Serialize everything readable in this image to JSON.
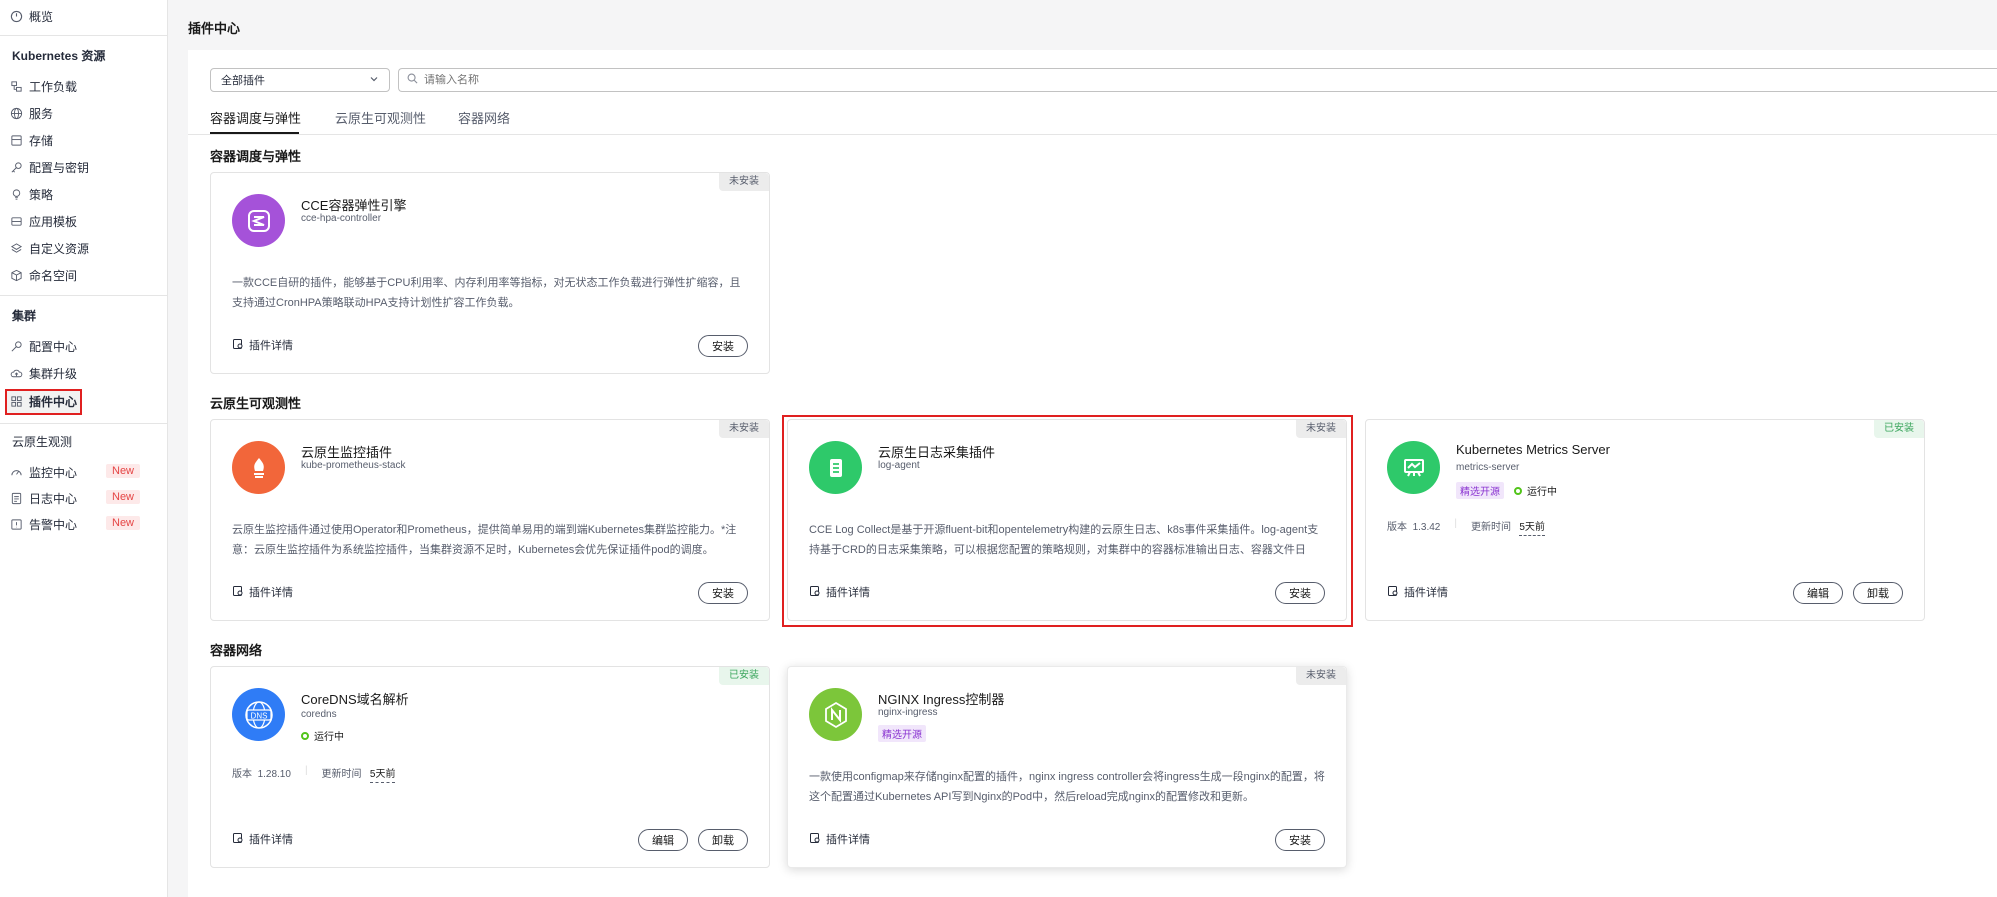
{
  "sidebar": {
    "top_item": "概览",
    "groups": [
      {
        "title": "Kubernetes 资源",
        "items": [
          "工作负载",
          "服务",
          "存储",
          "配置与密钥",
          "策略",
          "应用模板",
          "自定义资源",
          "命名空间"
        ]
      },
      {
        "title": "集群",
        "items": [
          "配置中心",
          "集群升级",
          "插件中心"
        ]
      },
      {
        "title": "云原生观测",
        "items": [
          "监控中心",
          "日志中心",
          "告警中心"
        ]
      }
    ],
    "new_badge": "New"
  },
  "page_title": "插件中心",
  "filter": {
    "selected": "全部插件",
    "search_placeholder": "请输入名称"
  },
  "tabs": [
    "容器调度与弹性",
    "云原生可观测性",
    "容器网络"
  ],
  "sections": [
    {
      "title": "容器调度与弹性",
      "cards": [
        {
          "name": "CCE容器弹性引擎",
          "id": "cce-hpa-controller",
          "status": "未安装",
          "desc": "一款CCE自研的插件，能够基于CPU利用率、内存利用率等指标，对无状态工作负载进行弹性扩缩容，且支持通过CronHPA策略联动HPA支持计划性扩容工作负载。",
          "detail": "插件详情",
          "buttons": [
            "安装"
          ]
        }
      ]
    },
    {
      "title": "云原生可观测性",
      "cards": [
        {
          "name": "云原生监控插件",
          "id": "kube-prometheus-stack",
          "status": "未安装",
          "desc": "云原生监控插件通过使用Operator和Prometheus，提供简单易用的端到端Kubernetes集群监控能力。*注意：云原生监控插件为系统监控插件，当集群资源不足时，Kubernetes会优先保证插件pod的调度。",
          "detail": "插件详情",
          "buttons": [
            "安装"
          ]
        },
        {
          "name": "云原生日志采集插件",
          "id": "log-agent",
          "status": "未安装",
          "desc": "CCE Log Collect是基于开源fluent-bit和opentelemetry构建的云原生日志、k8s事件采集插件。log-agent支持基于CRD的日志采集策略，可以根据您配置的策略规则，对集群中的容器标准输出日志、容器文件日志、…",
          "detail": "插件详情",
          "buttons": [
            "安装"
          ]
        },
        {
          "name": "Kubernetes Metrics Server",
          "id": "metrics-server",
          "status": "已安装",
          "tag": "精选开源",
          "running": "运行中",
          "version_label": "版本",
          "version": "1.3.42",
          "update_label": "更新时间",
          "update": "5天前",
          "detail": "插件详情",
          "buttons": [
            "编辑",
            "卸载"
          ]
        }
      ]
    },
    {
      "title": "容器网络",
      "cards": [
        {
          "name": "CoreDNS域名解析",
          "id": "coredns",
          "status": "已安装",
          "running": "运行中",
          "version_label": "版本",
          "version": "1.28.10",
          "update_label": "更新时间",
          "update": "5天前",
          "detail": "插件详情",
          "buttons": [
            "编辑",
            "卸载"
          ]
        },
        {
          "name": "NGINX Ingress控制器",
          "id": "nginx-ingress",
          "status": "未安装",
          "tag": "精选开源",
          "desc": "一款使用configmap来存储nginx配置的插件，nginx ingress controller会将ingress生成一段nginx的配置，将这个配置通过Kubernetes API写到Nginx的Pod中，然后reload完成nginx的配置修改和更新。",
          "detail": "插件详情",
          "buttons": [
            "安装"
          ]
        }
      ]
    }
  ],
  "colors": {
    "accent_highlight": "#e02020",
    "installed": "#3aa55c",
    "running": "#52c41a",
    "open_source": "#8a34d1"
  }
}
